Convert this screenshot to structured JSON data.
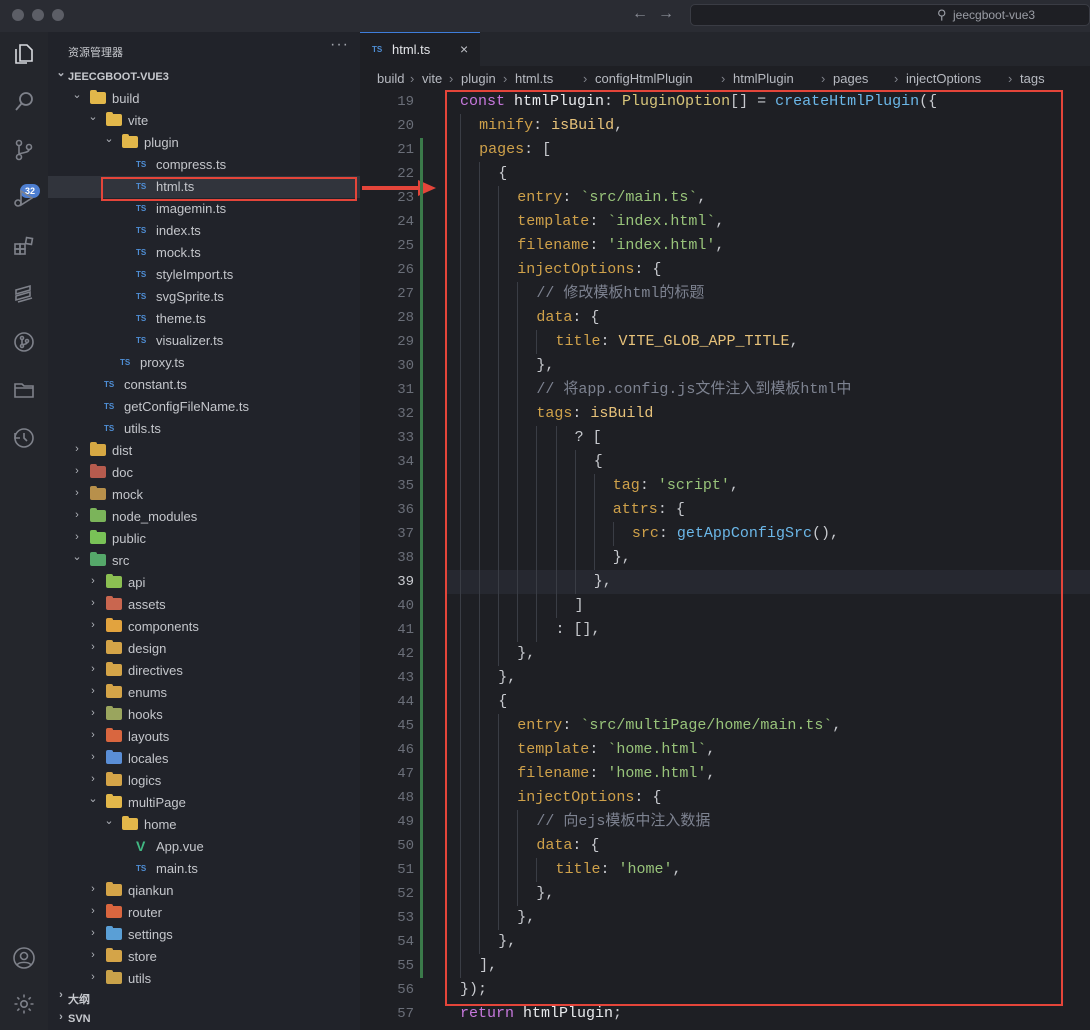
{
  "titlebar": {
    "search_text": "jeecgboot-vue3"
  },
  "activity": {
    "scm_badge": "32"
  },
  "explorer": {
    "title": "资源管理器",
    "more": "···",
    "items": [
      {
        "label": "JEECGBOOT-VUE3",
        "depth": 0,
        "kind": "root",
        "chevron": "open"
      },
      {
        "label": "build",
        "depth": 1,
        "kind": "folder",
        "chevron": "open",
        "color": "#e2b74a"
      },
      {
        "label": "vite",
        "depth": 2,
        "kind": "folder",
        "chevron": "open",
        "color": "#e2b74a"
      },
      {
        "label": "plugin",
        "depth": 3,
        "kind": "folder",
        "chevron": "open",
        "color": "#e2b74a"
      },
      {
        "label": "compress.ts",
        "depth": 4,
        "kind": "ts"
      },
      {
        "label": "html.ts",
        "depth": 4,
        "kind": "ts",
        "selected": true
      },
      {
        "label": "imagemin.ts",
        "depth": 4,
        "kind": "ts"
      },
      {
        "label": "index.ts",
        "depth": 4,
        "kind": "ts"
      },
      {
        "label": "mock.ts",
        "depth": 4,
        "kind": "ts"
      },
      {
        "label": "styleImport.ts",
        "depth": 4,
        "kind": "ts"
      },
      {
        "label": "svgSprite.ts",
        "depth": 4,
        "kind": "ts"
      },
      {
        "label": "theme.ts",
        "depth": 4,
        "kind": "ts"
      },
      {
        "label": "visualizer.ts",
        "depth": 4,
        "kind": "ts"
      },
      {
        "label": "proxy.ts",
        "depth": 3,
        "kind": "ts"
      },
      {
        "label": "constant.ts",
        "depth": 2,
        "kind": "ts"
      },
      {
        "label": "getConfigFileName.ts",
        "depth": 2,
        "kind": "ts"
      },
      {
        "label": "utils.ts",
        "depth": 2,
        "kind": "ts"
      },
      {
        "label": "dist",
        "depth": 1,
        "kind": "folder",
        "chevron": "closed",
        "color": "#d6a843"
      },
      {
        "label": "doc",
        "depth": 1,
        "kind": "folder",
        "chevron": "closed",
        "color": "#b65b4e"
      },
      {
        "label": "mock",
        "depth": 1,
        "kind": "folder",
        "chevron": "closed",
        "color": "#b8904b"
      },
      {
        "label": "node_modules",
        "depth": 1,
        "kind": "folder",
        "chevron": "closed",
        "color": "#7bb45a"
      },
      {
        "label": "public",
        "depth": 1,
        "kind": "folder",
        "chevron": "closed",
        "color": "#79c257"
      },
      {
        "label": "src",
        "depth": 1,
        "kind": "folder",
        "chevron": "open",
        "color": "#55a86a"
      },
      {
        "label": "api",
        "depth": 2,
        "kind": "folder",
        "chevron": "closed",
        "color": "#8bbf52"
      },
      {
        "label": "assets",
        "depth": 2,
        "kind": "folder",
        "chevron": "closed",
        "color": "#c9664f"
      },
      {
        "label": "components",
        "depth": 2,
        "kind": "folder",
        "chevron": "closed",
        "color": "#e2a33e"
      },
      {
        "label": "design",
        "depth": 2,
        "kind": "folder",
        "chevron": "closed",
        "color": "#d4a448"
      },
      {
        "label": "directives",
        "depth": 2,
        "kind": "folder",
        "chevron": "closed",
        "color": "#d4a448"
      },
      {
        "label": "enums",
        "depth": 2,
        "kind": "folder",
        "chevron": "closed",
        "color": "#d4a448"
      },
      {
        "label": "hooks",
        "depth": 2,
        "kind": "folder",
        "chevron": "closed",
        "color": "#9aa55e"
      },
      {
        "label": "layouts",
        "depth": 2,
        "kind": "folder",
        "chevron": "closed",
        "color": "#d9663f"
      },
      {
        "label": "locales",
        "depth": 2,
        "kind": "folder",
        "chevron": "closed",
        "color": "#5a8ed6"
      },
      {
        "label": "logics",
        "depth": 2,
        "kind": "folder",
        "chevron": "closed",
        "color": "#d4a448"
      },
      {
        "label": "multiPage",
        "depth": 2,
        "kind": "folder",
        "chevron": "open",
        "color": "#e2b74a"
      },
      {
        "label": "home",
        "depth": 3,
        "kind": "folder",
        "chevron": "open",
        "color": "#e2b74a"
      },
      {
        "label": "App.vue",
        "depth": 4,
        "kind": "vue"
      },
      {
        "label": "main.ts",
        "depth": 4,
        "kind": "ts"
      },
      {
        "label": "qiankun",
        "depth": 2,
        "kind": "folder",
        "chevron": "closed",
        "color": "#d4a448"
      },
      {
        "label": "router",
        "depth": 2,
        "kind": "folder",
        "chevron": "closed",
        "color": "#d9663f"
      },
      {
        "label": "settings",
        "depth": 2,
        "kind": "folder",
        "chevron": "closed",
        "color": "#5a9fd6"
      },
      {
        "label": "store",
        "depth": 2,
        "kind": "folder",
        "chevron": "closed",
        "color": "#d4a448"
      },
      {
        "label": "utils",
        "depth": 2,
        "kind": "folder",
        "chevron": "closed",
        "color": "#c9a24a"
      },
      {
        "label": "大纲",
        "depth": 0,
        "kind": "root",
        "chevron": "closed"
      },
      {
        "label": "SVN",
        "depth": 0,
        "kind": "root",
        "chevron": "closed"
      }
    ]
  },
  "editor": {
    "tab": {
      "icon": "TS",
      "label": "html.ts",
      "close": "×"
    },
    "breadcrumb": [
      "build",
      "vite",
      "plugin",
      "html.ts",
      "configHtmlPlugin",
      "htmlPlugin",
      "pages",
      "injectOptions",
      "tags"
    ],
    "current_line": 39,
    "lines": [
      {
        "n": 19,
        "indent": 0,
        "tokens": [
          [
            "kw",
            "const "
          ],
          [
            "var",
            "htmlPlugin"
          ],
          [
            "pun",
            ": "
          ],
          [
            "type",
            "PluginOption"
          ],
          [
            "pun",
            "[] = "
          ],
          [
            "fn",
            "createHtmlPlugin"
          ],
          [
            "pun",
            "({"
          ]
        ]
      },
      {
        "n": 20,
        "indent": 1,
        "tokens": [
          [
            "prop",
            "minify"
          ],
          [
            "pun",
            ": "
          ],
          [
            "const",
            "isBuild"
          ],
          [
            "pun",
            ","
          ]
        ]
      },
      {
        "n": 21,
        "indent": 1,
        "tokens": [
          [
            "prop",
            "pages"
          ],
          [
            "pun",
            ": ["
          ]
        ]
      },
      {
        "n": 22,
        "indent": 2,
        "tokens": [
          [
            "pun",
            "{"
          ]
        ]
      },
      {
        "n": 23,
        "indent": 3,
        "tokens": [
          [
            "prop",
            "entry"
          ],
          [
            "pun",
            ": "
          ],
          [
            "str",
            "`src/main.ts`"
          ],
          [
            "pun",
            ","
          ]
        ]
      },
      {
        "n": 24,
        "indent": 3,
        "tokens": [
          [
            "prop",
            "template"
          ],
          [
            "pun",
            ": "
          ],
          [
            "str",
            "`index.html`"
          ],
          [
            "pun",
            ","
          ]
        ]
      },
      {
        "n": 25,
        "indent": 3,
        "tokens": [
          [
            "prop",
            "filename"
          ],
          [
            "pun",
            ": "
          ],
          [
            "str",
            "'index.html'"
          ],
          [
            "pun",
            ","
          ]
        ]
      },
      {
        "n": 26,
        "indent": 3,
        "tokens": [
          [
            "prop",
            "injectOptions"
          ],
          [
            "pun",
            ": {"
          ]
        ]
      },
      {
        "n": 27,
        "indent": 4,
        "tokens": [
          [
            "cmt",
            "// 修改模板html的标题"
          ]
        ]
      },
      {
        "n": 28,
        "indent": 4,
        "tokens": [
          [
            "prop",
            "data"
          ],
          [
            "pun",
            ": {"
          ]
        ]
      },
      {
        "n": 29,
        "indent": 5,
        "tokens": [
          [
            "prop",
            "title"
          ],
          [
            "pun",
            ": "
          ],
          [
            "const",
            "VITE_GLOB_APP_TITLE"
          ],
          [
            "pun",
            ","
          ]
        ]
      },
      {
        "n": 30,
        "indent": 4,
        "tokens": [
          [
            "pun",
            "},"
          ]
        ]
      },
      {
        "n": 31,
        "indent": 4,
        "tokens": [
          [
            "cmt",
            "// 将app.config.js文件注入到模板html中"
          ]
        ]
      },
      {
        "n": 32,
        "indent": 4,
        "tokens": [
          [
            "prop",
            "tags"
          ],
          [
            "pun",
            ": "
          ],
          [
            "const",
            "isBuild"
          ]
        ]
      },
      {
        "n": 33,
        "indent": 6,
        "tokens": [
          [
            "pun",
            "? ["
          ]
        ]
      },
      {
        "n": 34,
        "indent": 7,
        "tokens": [
          [
            "pun",
            "{"
          ]
        ]
      },
      {
        "n": 35,
        "indent": 8,
        "tokens": [
          [
            "prop",
            "tag"
          ],
          [
            "pun",
            ": "
          ],
          [
            "str",
            "'script'"
          ],
          [
            "pun",
            ","
          ]
        ]
      },
      {
        "n": 36,
        "indent": 8,
        "tokens": [
          [
            "prop",
            "attrs"
          ],
          [
            "pun",
            ": {"
          ]
        ]
      },
      {
        "n": 37,
        "indent": 9,
        "tokens": [
          [
            "prop",
            "src"
          ],
          [
            "pun",
            ": "
          ],
          [
            "fn",
            "getAppConfigSrc"
          ],
          [
            "pun",
            "(),"
          ]
        ]
      },
      {
        "n": 38,
        "indent": 8,
        "tokens": [
          [
            "pun",
            "},"
          ]
        ]
      },
      {
        "n": 39,
        "indent": 7,
        "tokens": [
          [
            "pun",
            "},"
          ]
        ]
      },
      {
        "n": 40,
        "indent": 6,
        "tokens": [
          [
            "pun",
            "]"
          ]
        ]
      },
      {
        "n": 41,
        "indent": 5,
        "tokens": [
          [
            "pun",
            ": [],"
          ]
        ]
      },
      {
        "n": 42,
        "indent": 3,
        "tokens": [
          [
            "pun",
            "},"
          ]
        ]
      },
      {
        "n": 43,
        "indent": 2,
        "tokens": [
          [
            "pun",
            "},"
          ]
        ]
      },
      {
        "n": 44,
        "indent": 2,
        "tokens": [
          [
            "pun",
            "{"
          ]
        ]
      },
      {
        "n": 45,
        "indent": 3,
        "tokens": [
          [
            "prop",
            "entry"
          ],
          [
            "pun",
            ": "
          ],
          [
            "str",
            "`src/multiPage/home/main.ts`"
          ],
          [
            "pun",
            ","
          ]
        ]
      },
      {
        "n": 46,
        "indent": 3,
        "tokens": [
          [
            "prop",
            "template"
          ],
          [
            "pun",
            ": "
          ],
          [
            "str",
            "`home.html`"
          ],
          [
            "pun",
            ","
          ]
        ]
      },
      {
        "n": 47,
        "indent": 3,
        "tokens": [
          [
            "prop",
            "filename"
          ],
          [
            "pun",
            ": "
          ],
          [
            "str",
            "'home.html'"
          ],
          [
            "pun",
            ","
          ]
        ]
      },
      {
        "n": 48,
        "indent": 3,
        "tokens": [
          [
            "prop",
            "injectOptions"
          ],
          [
            "pun",
            ": {"
          ]
        ]
      },
      {
        "n": 49,
        "indent": 4,
        "tokens": [
          [
            "cmt",
            "// 向ejs模板中注入数据"
          ]
        ]
      },
      {
        "n": 50,
        "indent": 4,
        "tokens": [
          [
            "prop",
            "data"
          ],
          [
            "pun",
            ": {"
          ]
        ]
      },
      {
        "n": 51,
        "indent": 5,
        "tokens": [
          [
            "prop",
            "title"
          ],
          [
            "pun",
            ": "
          ],
          [
            "str",
            "'home'"
          ],
          [
            "pun",
            ","
          ]
        ]
      },
      {
        "n": 52,
        "indent": 4,
        "tokens": [
          [
            "pun",
            "},"
          ]
        ]
      },
      {
        "n": 53,
        "indent": 3,
        "tokens": [
          [
            "pun",
            "},"
          ]
        ]
      },
      {
        "n": 54,
        "indent": 2,
        "tokens": [
          [
            "pun",
            "},"
          ]
        ]
      },
      {
        "n": 55,
        "indent": 1,
        "tokens": [
          [
            "pun",
            "],"
          ]
        ]
      },
      {
        "n": 56,
        "indent": 0,
        "tokens": [
          [
            "pun",
            "});"
          ]
        ]
      },
      {
        "n": 57,
        "indent": 0,
        "tokens": [
          [
            "kw",
            "return "
          ],
          [
            "var",
            "htmlPlugin"
          ],
          [
            "pun",
            ";"
          ]
        ]
      }
    ]
  }
}
